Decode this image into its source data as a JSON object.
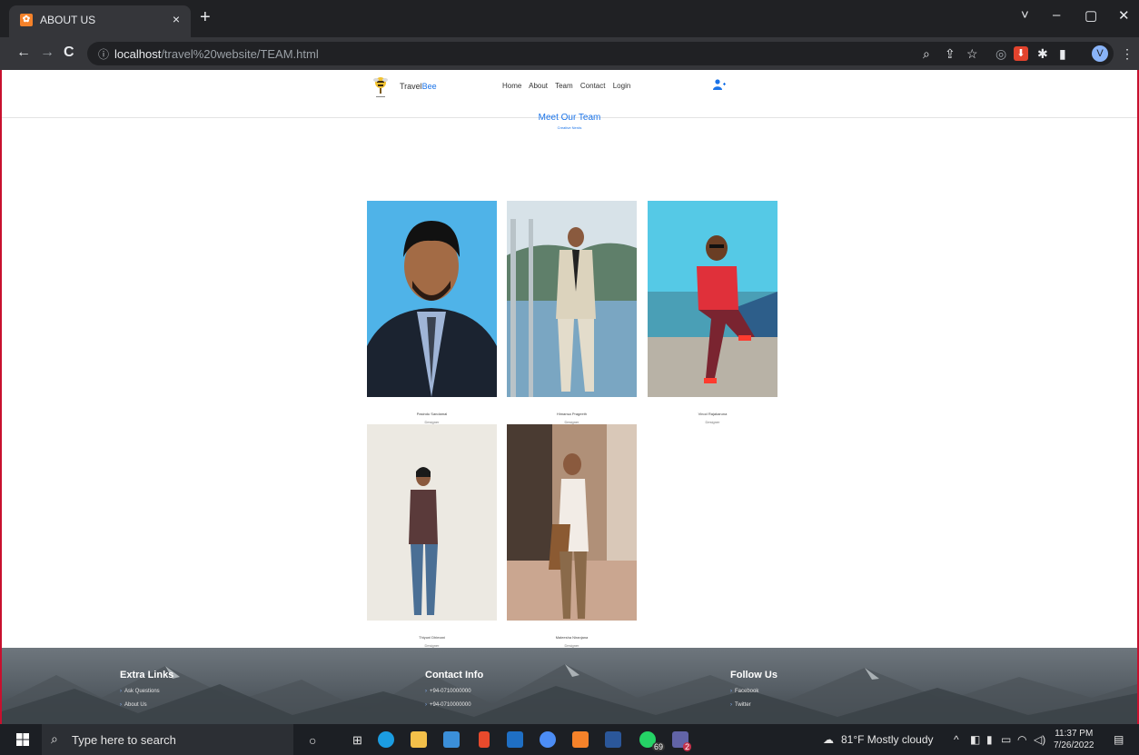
{
  "browser": {
    "tab_title": "ABOUT US",
    "tab_close": "×",
    "new_tab": "+",
    "url_host": "localhost",
    "url_path": "/travel%20website/TEAM.html",
    "nav_back": "←",
    "nav_forward": "→",
    "nav_reload": "C",
    "window_controls": [
      "˅",
      "–",
      "▢",
      "✕"
    ],
    "profile_initial": "V"
  },
  "site": {
    "brand_prefix": "Travel",
    "brand_suffix": "Bee",
    "nav": [
      "Home",
      "About",
      "Team",
      "Contact",
      "Login"
    ],
    "title": "Meet Our Team",
    "subtitle": "Creative Nerds"
  },
  "team": [
    {
      "name": "Pasindu Sandamal",
      "role": "Designer",
      "bg": "#4fb3e8"
    },
    {
      "name": "Himansa Prageeth",
      "role": "Designer",
      "bg": "#9fb8c4"
    },
    {
      "name": "Vinod Rajakaruna",
      "role": "Designer",
      "bg": "#55c9e6"
    },
    {
      "name": "Thiyuni Dhimani",
      "role": "Designer",
      "bg": "#ece9e2"
    },
    {
      "name": "Maleesha Niranjana",
      "role": "Designer",
      "bg": "#b09078"
    }
  ],
  "footer": {
    "extra_title": "Extra Links",
    "extra_links": [
      "Ask Questions",
      "About Us"
    ],
    "contact_title": "Contact Info",
    "contact_items": [
      "+94-0710000000",
      "+94-0710000000"
    ],
    "follow_title": "Follow Us",
    "follow_links": [
      "Facebook",
      "Twitter"
    ]
  },
  "taskbar": {
    "search_placeholder": "Type here to search",
    "weather": "81°F  Mostly cloudy",
    "time": "11:37 PM",
    "date": "7/26/2022",
    "whatsapp_badge": "69",
    "teams_badge": "2"
  }
}
